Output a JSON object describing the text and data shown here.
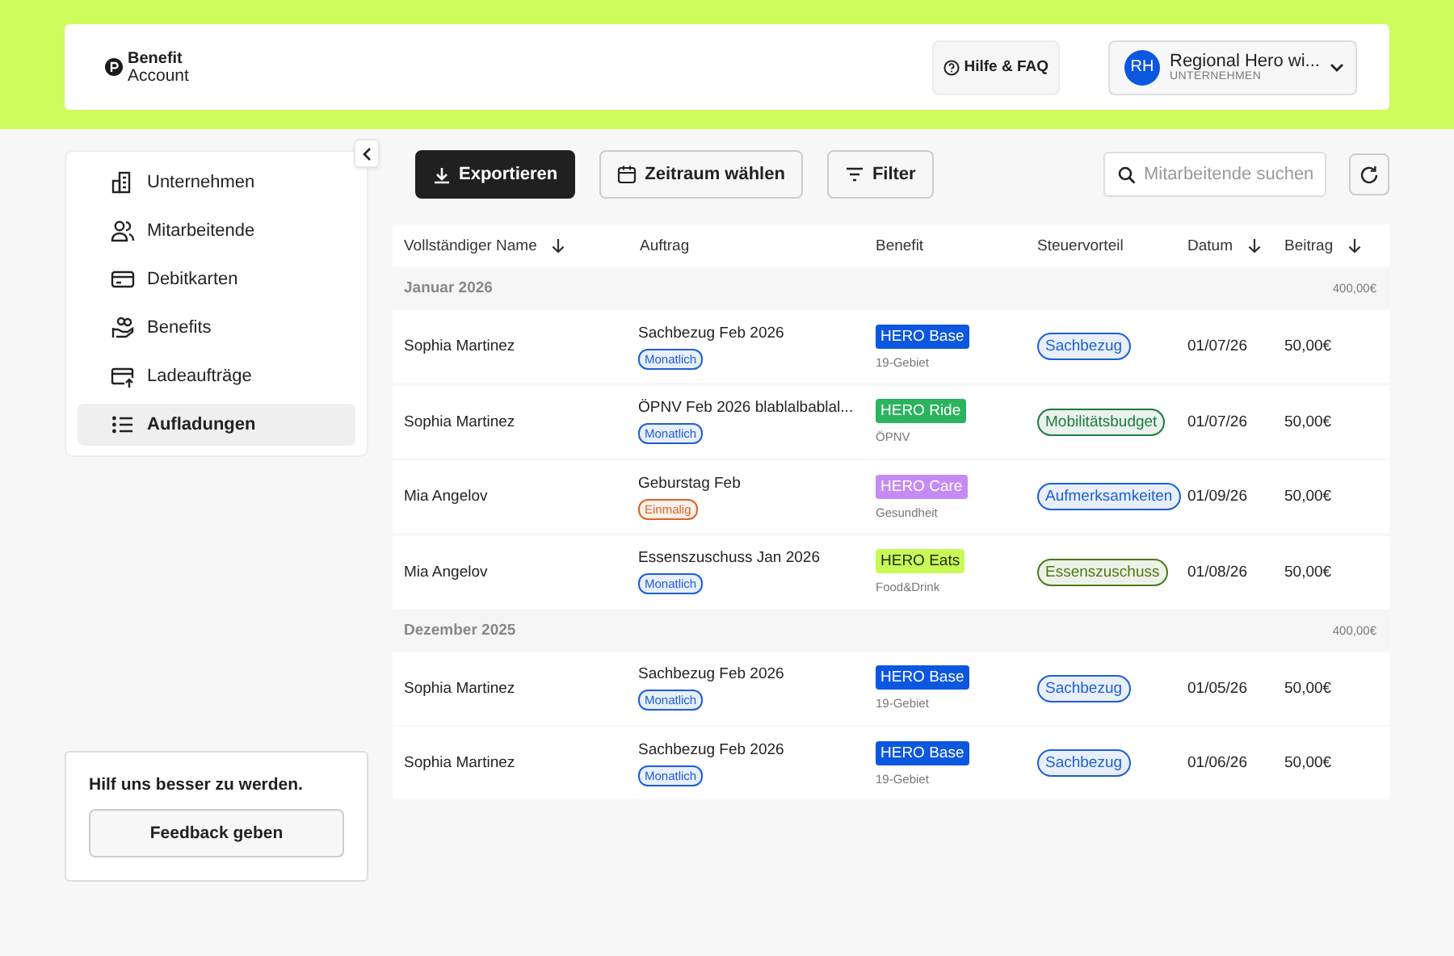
{
  "header": {
    "logo_line_1": "Benefit",
    "logo_line_2": "Account",
    "help_button": "Hilfe & FAQ",
    "account": {
      "initials": "RH",
      "name": "Regional Hero wi...",
      "role": "UNTERNEHMEN"
    }
  },
  "sidebar": {
    "items": [
      {
        "label": "Unternehmen",
        "selected": false
      },
      {
        "label": "Mitarbeitende",
        "selected": false
      },
      {
        "label": "Debitkarten",
        "selected": false
      },
      {
        "label": "Benefits",
        "selected": false
      },
      {
        "label": "Ladeaufträge",
        "selected": false
      },
      {
        "label": "Aufladungen",
        "selected": true
      }
    ]
  },
  "feedback": {
    "text": "Hilf uns besser zu werden.",
    "button": "Feedback geben"
  },
  "toolbar": {
    "export_button": "Exportieren",
    "period_button": "Zeitraum wählen",
    "filter_button": "Filter",
    "search": {
      "placeholder": "Mitarbeitende suchen"
    }
  },
  "table": {
    "columns": [
      {
        "label": "Vollständiger Name",
        "sortable": true
      },
      {
        "label": "Auftrag",
        "sortable": false
      },
      {
        "label": "Benefit",
        "sortable": false
      },
      {
        "label": "Steuervorteil",
        "sortable": false
      },
      {
        "label": "Datum",
        "sortable": true
      },
      {
        "label": "Beitrag",
        "sortable": true
      }
    ],
    "groups": [
      {
        "label": "Januar 2026",
        "total": "400,00€",
        "rows": [
          {
            "name": "Sophia Martinez",
            "order": "Sachbezug Feb 2026",
            "frequency": {
              "label": "Monatlich",
              "color": "#1d5fd6"
            },
            "benefit": {
              "label": "HERO Base",
              "color": "#0b57e0"
            },
            "category": "19-Gebiet",
            "tax": {
              "label": "Sachbezug",
              "color": "#1d5fd6"
            },
            "date": "01/07/26",
            "amount": "50,00€"
          },
          {
            "name": "Sophia Martinez",
            "order": "ÖPNV Feb 2026 blablalbablal...",
            "frequency": {
              "label": "Monatlich",
              "color": "#1d5fd6"
            },
            "benefit": {
              "label": "HERO Ride",
              "color": "#2bb35e"
            },
            "category": "ÖPNV",
            "tax": {
              "label": "Mobilitätsbudget",
              "color": "#1f7a3f"
            },
            "date": "01/07/26",
            "amount": "50,00€"
          },
          {
            "name": "Mia Angelov",
            "order": "Geburstag Feb",
            "frequency": {
              "label": "Einmalig",
              "color": "#d9652b"
            },
            "benefit": {
              "label": "HERO Care",
              "color": "#c58af5"
            },
            "category": "Gesundheit",
            "tax": {
              "label": "Aufmerksamkeiten",
              "color": "#1d5fd6"
            },
            "date": "01/09/26",
            "amount": "50,00€"
          },
          {
            "name": "Mia Angelov",
            "order": "Essenszuschuss Jan 2026",
            "frequency": {
              "label": "Monatlich",
              "color": "#1d5fd6"
            },
            "benefit": {
              "label": "HERO Eats",
              "color": "#c8fa55"
            },
            "category": "Food&Drink",
            "tax": {
              "label": "Essenszuschuss",
              "color": "#4a7a16"
            },
            "date": "01/08/26",
            "amount": "50,00€"
          }
        ]
      },
      {
        "label": "Dezember 2025",
        "total": "400,00€",
        "rows": [
          {
            "name": "Sophia Martinez",
            "order": "Sachbezug Feb 2026",
            "frequency": {
              "label": "Monatlich",
              "color": "#1d5fd6"
            },
            "benefit": {
              "label": "HERO Base",
              "color": "#0b57e0"
            },
            "category": "19-Gebiet",
            "tax": {
              "label": "Sachbezug",
              "color": "#1d5fd6"
            },
            "date": "01/05/26",
            "amount": "50,00€"
          },
          {
            "name": "Sophia Martinez",
            "order": "Sachbezug Feb 2026",
            "frequency": {
              "label": "Monatlich",
              "color": "#1d5fd6"
            },
            "benefit": {
              "label": "HERO Base",
              "color": "#0b57e0"
            },
            "category": "19-Gebiet",
            "tax": {
              "label": "Sachbezug",
              "color": "#1d5fd6"
            },
            "date": "01/06/26",
            "amount": "50,00€"
          }
        ]
      }
    ]
  }
}
